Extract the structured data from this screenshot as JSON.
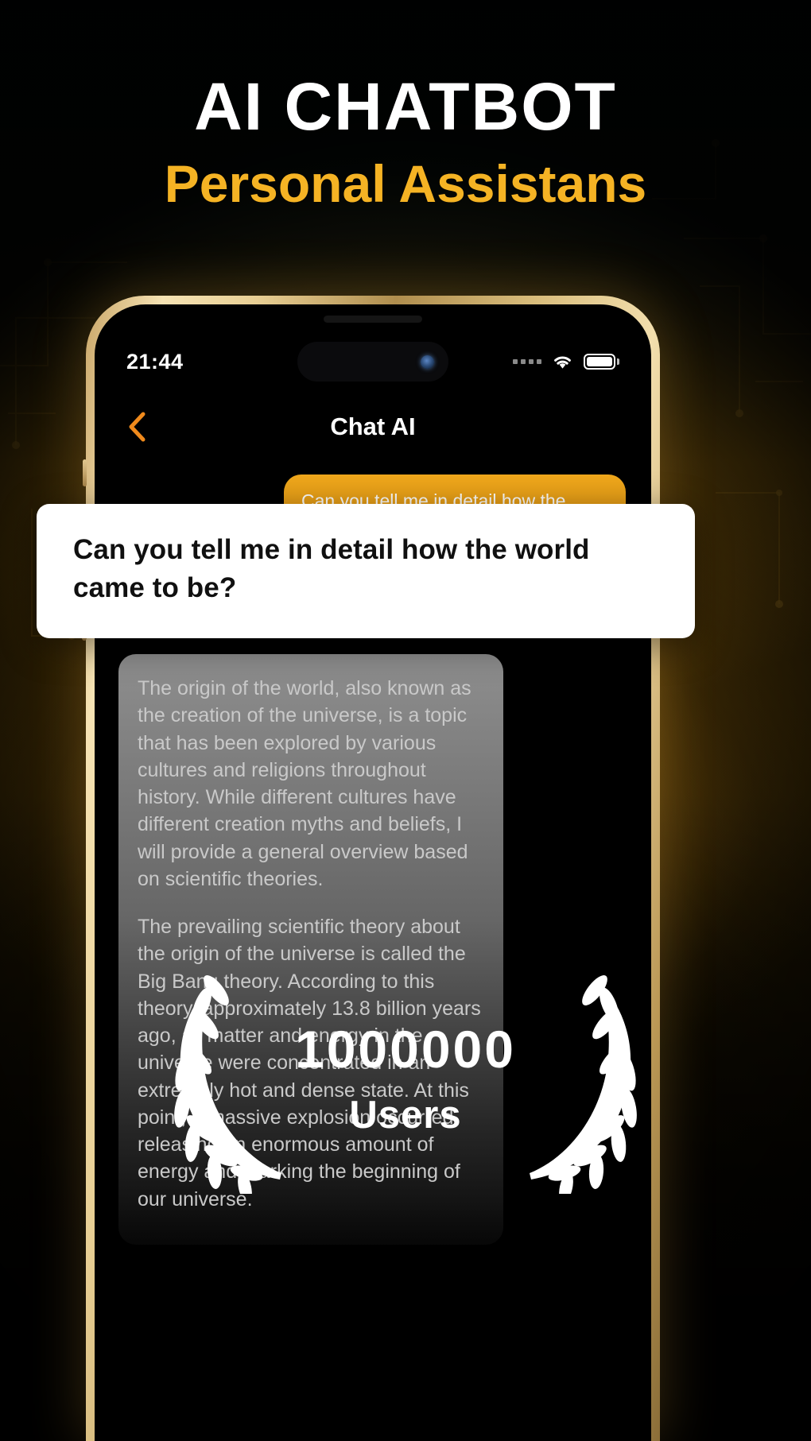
{
  "header": {
    "title": "AI CHATBOT",
    "subtitle": "Personal Assistans",
    "title_color": "#FFFFFF",
    "subtitle_color": "#F5B324"
  },
  "phone": {
    "status_bar": {
      "time": "21:44",
      "signal_icon": "signal-dots-icon",
      "wifi_icon": "wifi-icon",
      "battery_icon": "battery-full-icon"
    },
    "nav_bar": {
      "back_icon": "chevron-left-icon",
      "title": "Chat AI",
      "back_color": "#F08A1C"
    },
    "chat": {
      "user_message": "Can you tell me in detail how the world came to be?",
      "ai_paragraphs": [
        "The origin of the world, also known as the creation of the universe, is a topic that has been explored by various cultures and religions throughout history. While different cultures have different creation myths and beliefs, I will provide a general overview based on scientific theories.",
        "The prevailing scientific theory about the origin of the universe is called the Big Bang theory. According to this theory, approximately 13.8 billion years ago, all matter and energy in the universe were concentrated in an extremely hot and dense state. At this point, a massive explosion occurred, releasing an enormous amount of energy and marking the beginning of our universe."
      ]
    }
  },
  "overlay_card": {
    "text": "Can you tell me in detail how the world came to be?"
  },
  "users_badge": {
    "count": "1000000",
    "label": "Users",
    "wreath_icon": "laurel-wreath-icon"
  }
}
